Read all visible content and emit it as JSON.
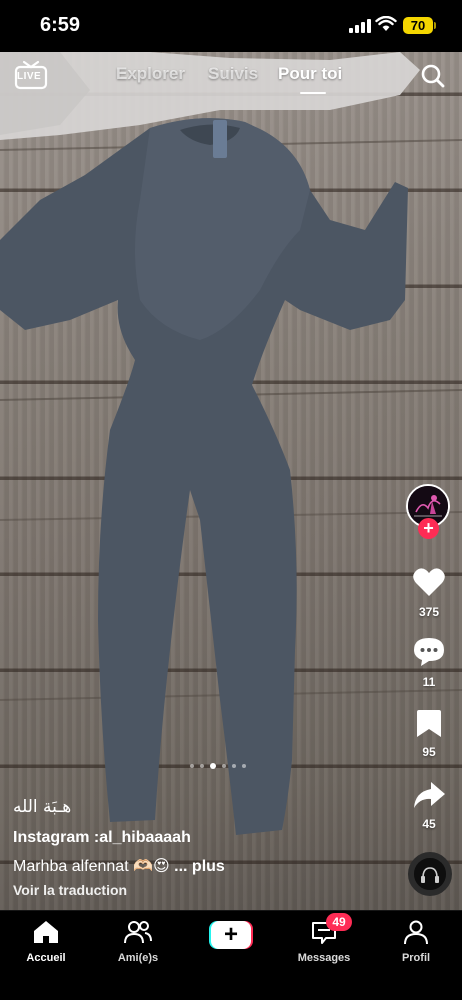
{
  "status_bar": {
    "time": "6:59",
    "battery": "70"
  },
  "top_nav": {
    "live_label": "LIVE",
    "tabs": [
      {
        "label": "Explorer",
        "active": false
      },
      {
        "label": "Suivis",
        "active": false
      },
      {
        "label": "Pour toi",
        "active": true
      }
    ]
  },
  "right_rail": {
    "likes": "375",
    "comments": "11",
    "saves": "95",
    "shares": "45"
  },
  "carousel": {
    "count": 6,
    "active_index": 2
  },
  "caption": {
    "arabic_text": "هـبَة الله",
    "handle": "Instagram :al_hibaaaah",
    "text": "Marhba alfennat 🫶🏻😍",
    "more": "... plus",
    "translate": "Voir la traduction"
  },
  "bottom_nav": {
    "items": [
      {
        "label": "Accueil",
        "icon": "home-icon",
        "active": true
      },
      {
        "label": "Ami(e)s",
        "icon": "friends-icon",
        "active": false
      },
      {
        "label": "",
        "icon": "create-icon",
        "active": false
      },
      {
        "label": "Messages",
        "icon": "inbox-icon",
        "active": false
      },
      {
        "label": "Profil",
        "icon": "profile-icon",
        "active": false
      }
    ],
    "messages_badge": "49"
  },
  "colors": {
    "accent": "#fe2c55",
    "cyan": "#25f4ee",
    "battery": "#f4d600"
  }
}
